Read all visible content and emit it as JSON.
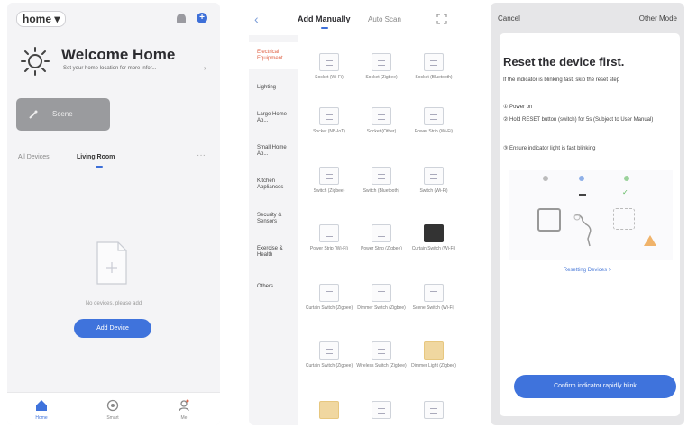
{
  "colors": {
    "accent": "#3f73dc",
    "active_category": "#e06548",
    "scene_button": "#9a9b9e"
  },
  "home_screen": {
    "home_selector": "home",
    "title": "Welcome Home",
    "location_hint": "Set your home location for more infor...",
    "scene_button_label": "Scene",
    "tabs": [
      "All Devices",
      "Living Room"
    ],
    "empty_message": "No devices, please add",
    "add_device_label": "Add Device",
    "nav": [
      "Home",
      "Smart",
      "Me"
    ],
    "icons": [
      "bell-icon",
      "plus-icon",
      "sun-icon",
      "document-icon",
      "home-icon",
      "smart-icon",
      "profile-icon"
    ]
  },
  "add_device_screen": {
    "tabs": [
      "Add Manually",
      "Auto Scan"
    ],
    "categories": [
      "Electrical Equipment",
      "Lighting",
      "Large Home Ap...",
      "Small Home Ap...",
      "Kitchen Appliances",
      "Security & Sensors",
      "Exercise & Health",
      "Others"
    ],
    "devices": [
      {
        "label": "Socket (Wi-Fi)",
        "style": "plain"
      },
      {
        "label": "Socket (Zigbee)",
        "style": "plain"
      },
      {
        "label": "Socket (Bluetooth)",
        "style": "plain"
      },
      {
        "label": "Socket (NB-IoT)",
        "style": "plain"
      },
      {
        "label": "Socket (Other)",
        "style": "plain"
      },
      {
        "label": "Power Strip (Wi-Fi)",
        "style": "plain"
      },
      {
        "label": "Switch (Zigbee)",
        "style": "plain"
      },
      {
        "label": "Switch (Bluetooth)",
        "style": "plain"
      },
      {
        "label": "Switch (Wi-Fi)",
        "style": "plain"
      },
      {
        "label": "Power Strip (Wi-Fi)",
        "style": "plain"
      },
      {
        "label": "Power Strip (Zigbee)",
        "style": "plain"
      },
      {
        "label": "Curtain Switch (Wi-Fi)",
        "style": "dark"
      },
      {
        "label": "Curtain Switch (Zigbee)",
        "style": "plain"
      },
      {
        "label": "Dimmer Switch (Zigbee)",
        "style": "plain"
      },
      {
        "label": "Scene Switch (Wi-Fi)",
        "style": "plain"
      },
      {
        "label": "Curtain Switch (Zigbee)",
        "style": "plain"
      },
      {
        "label": "Wireless Switch (Zigbee)",
        "style": "plain"
      },
      {
        "label": "Dimmer Light (Zigbee)",
        "style": "gold"
      },
      {
        "label": "",
        "style": "gold"
      },
      {
        "label": "",
        "style": "plain"
      },
      {
        "label": "",
        "style": "plain"
      }
    ]
  },
  "reset_screen": {
    "cancel_label": "Cancel",
    "other_label": "Other Mode",
    "title": "Reset the device first.",
    "instructions": [
      "If the indicator is blinking fast, skip the reset step",
      "① Power on",
      "② Hold RESET button (switch) for 5s (Subject to User Manual)",
      "③ Ensure indicator light is fast blinking"
    ],
    "resetting_link": "Resetting Devices >",
    "confirm_label": "Confirm indicator rapidly blink"
  }
}
